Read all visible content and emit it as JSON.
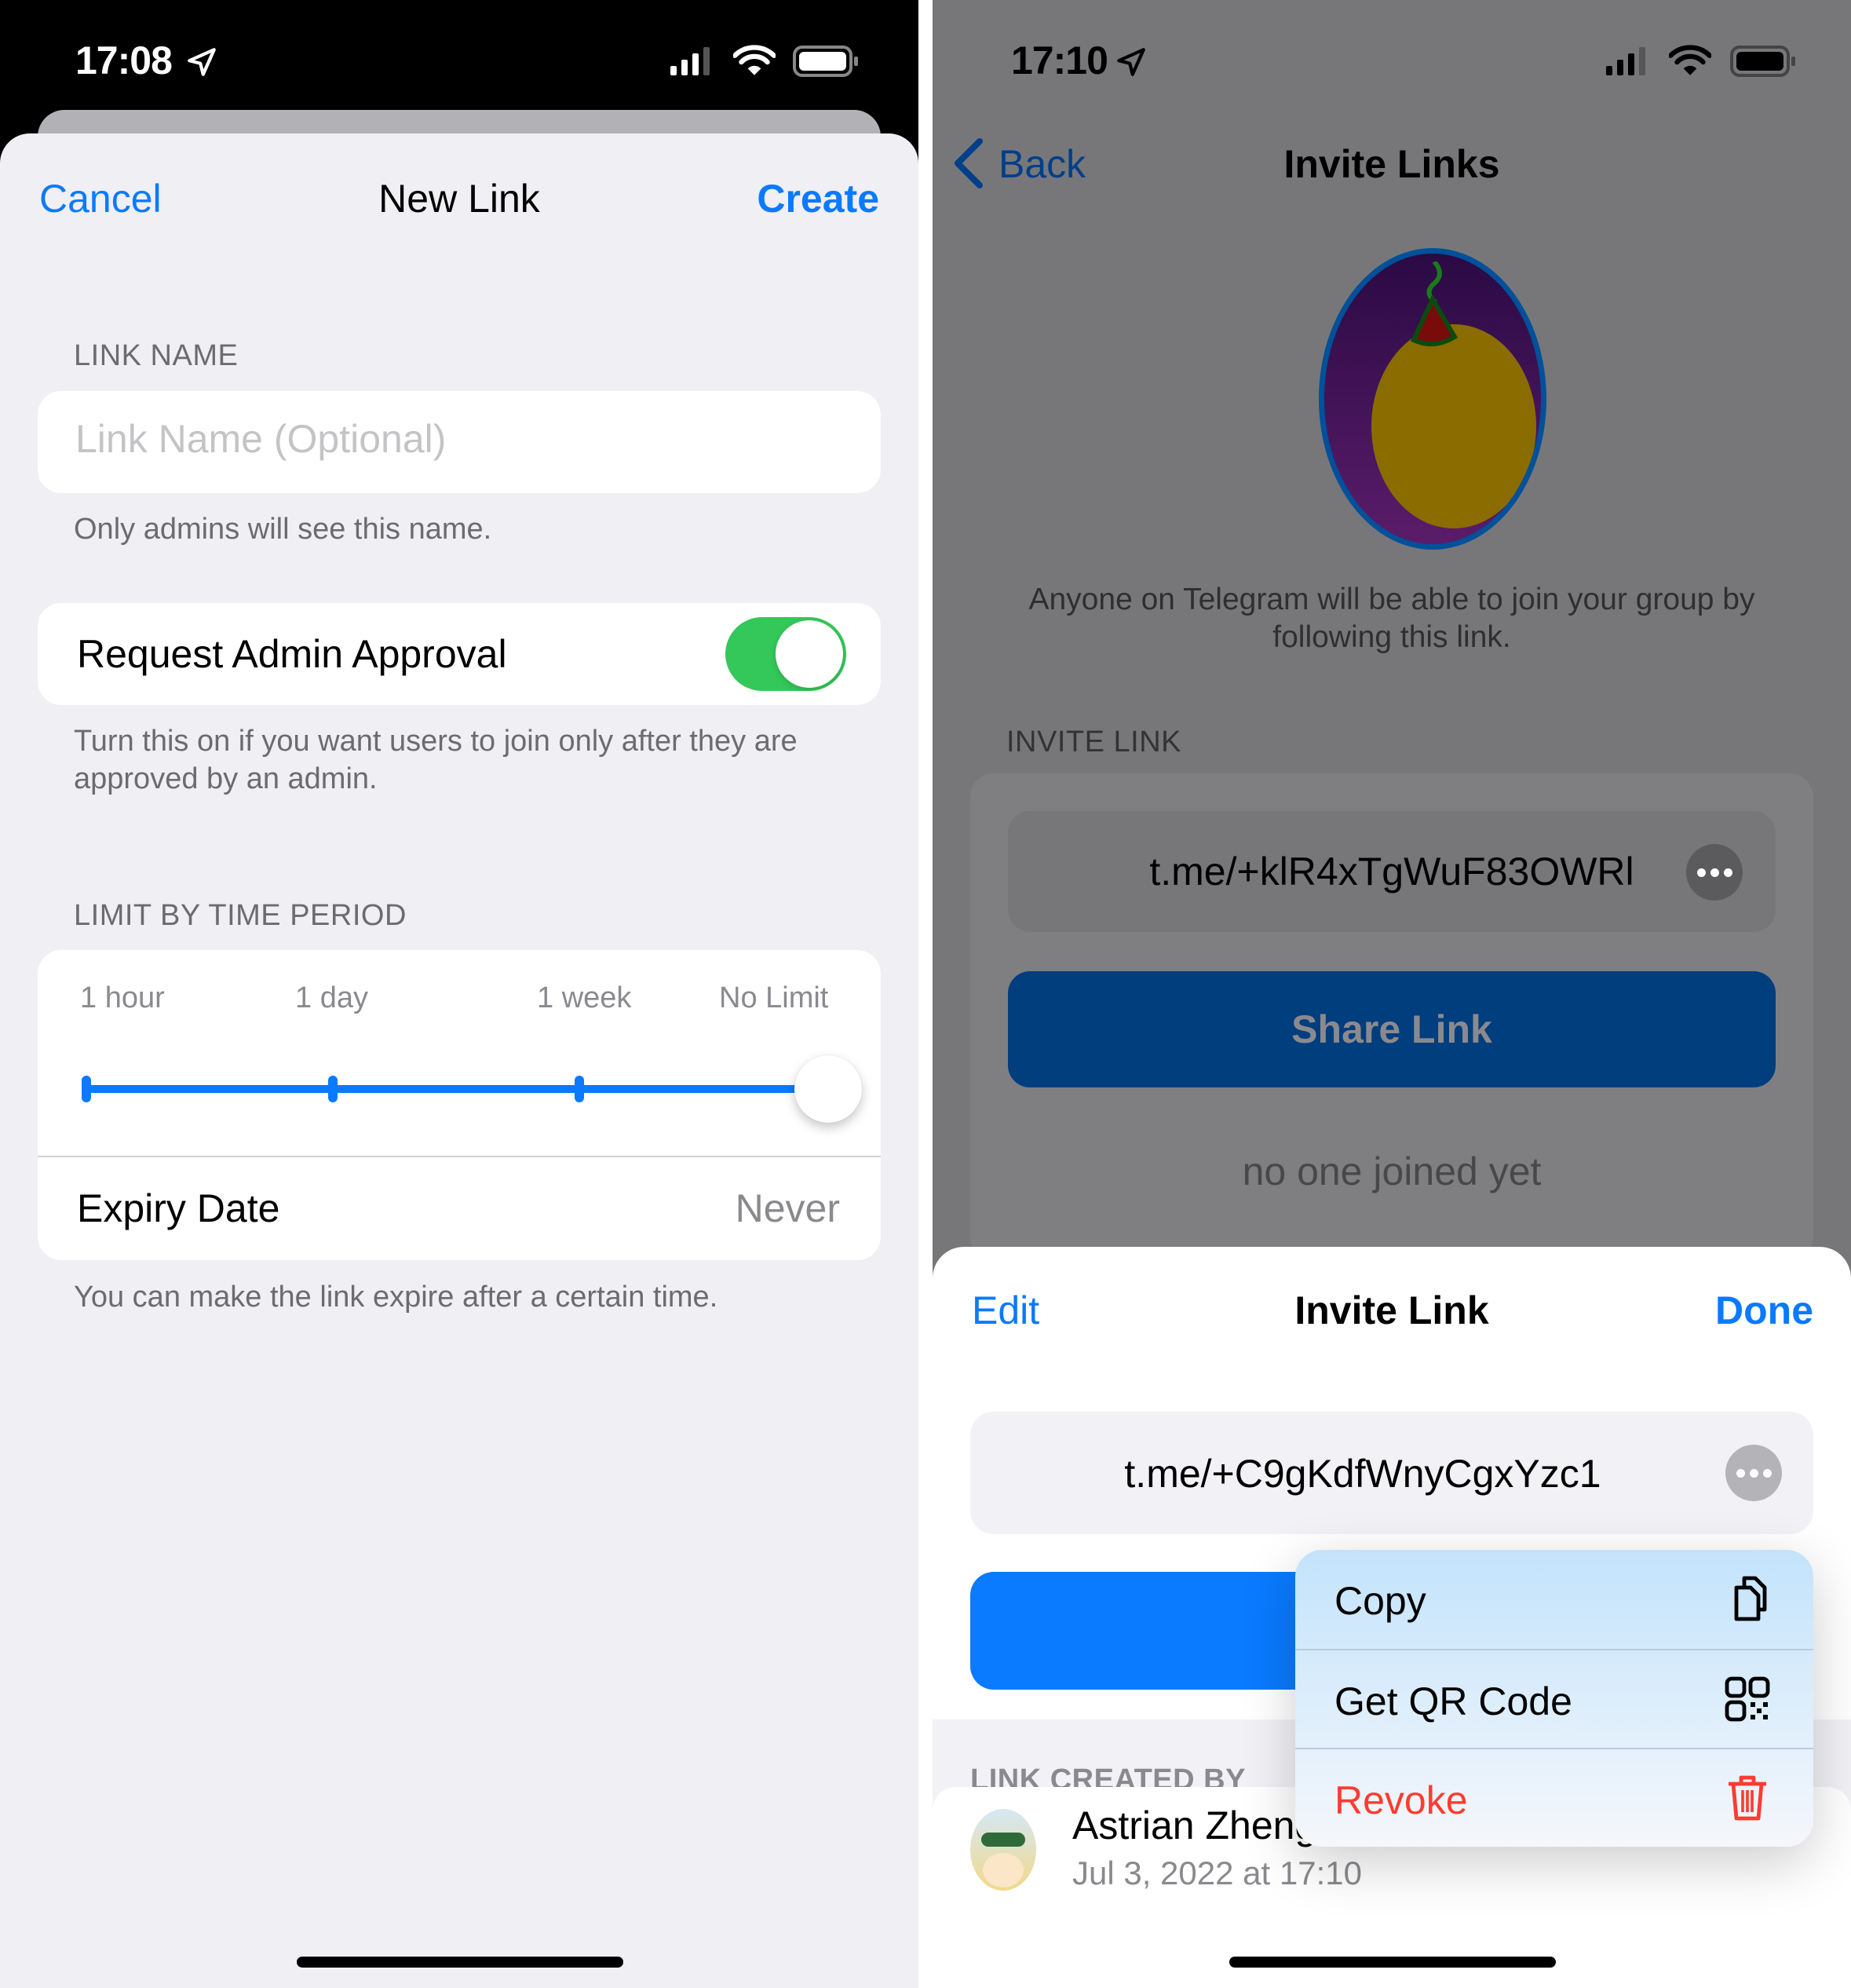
{
  "left": {
    "status_bar": {
      "time": "17:08",
      "location_icon": "location-arrow-icon",
      "signal_icon": "cellular-signal-icon",
      "wifi_icon": "wifi-icon",
      "battery_icon": "battery-icon"
    },
    "nav": {
      "cancel_label": "Cancel",
      "title": "New Link",
      "create_label": "Create"
    },
    "link_name": {
      "section_label": "LINK NAME",
      "value": "",
      "placeholder": "Link Name (Optional)",
      "help": "Only admins will see this name."
    },
    "admin_approval": {
      "label": "Request Admin Approval",
      "enabled": true,
      "help": "Turn this on if you want users to join only after they are approved by an admin."
    },
    "time_limit": {
      "section_label": "LIMIT BY TIME PERIOD",
      "options": [
        "1 hour",
        "1 day",
        "1 week",
        "No Limit"
      ],
      "selected_index": 3,
      "selected": "No Limit",
      "expiry_label": "Expiry Date",
      "expiry_value": "Never",
      "help": "You can make the link expire after a certain time."
    }
  },
  "right": {
    "status_bar": {
      "time": "17:10",
      "location_icon": "location-arrow-icon",
      "signal_icon": "cellular-signal-icon",
      "wifi_icon": "wifi-icon",
      "battery_icon": "battery-icon"
    },
    "nav": {
      "back_label": "Back",
      "title": "Invite Links"
    },
    "group_avatar": "group-avatar-party-duck",
    "description": "Anyone on Telegram will be able to join your group by following this link.",
    "invite_link": {
      "section_label": "INVITE LINK",
      "url": "t.me/+klR4xTgWuF83OWRl",
      "share_label": "Share Link",
      "joined_status": "no one joined yet"
    },
    "sheet": {
      "edit_label": "Edit",
      "title": "Invite Link",
      "done_label": "Done",
      "url": "t.me/+C9gKdfWnyCgxYzc1",
      "created_by_label": "LINK CREATED BY",
      "creator": {
        "name": "Astrian Zheng",
        "date": "Jul 3, 2022 at 17:10"
      },
      "context_menu": [
        {
          "label": "Copy",
          "icon": "copy-icon",
          "destructive": false
        },
        {
          "label": "Get QR Code",
          "icon": "qr-code-icon",
          "destructive": false
        },
        {
          "label": "Revoke",
          "icon": "trash-icon",
          "destructive": true
        }
      ]
    }
  },
  "colors": {
    "accent": "#0a7aff",
    "toggle_on": "#34c759",
    "destructive": "#ff3b30",
    "grouped_bg": "#efeff4",
    "secondary_text": "#6c6c70"
  }
}
